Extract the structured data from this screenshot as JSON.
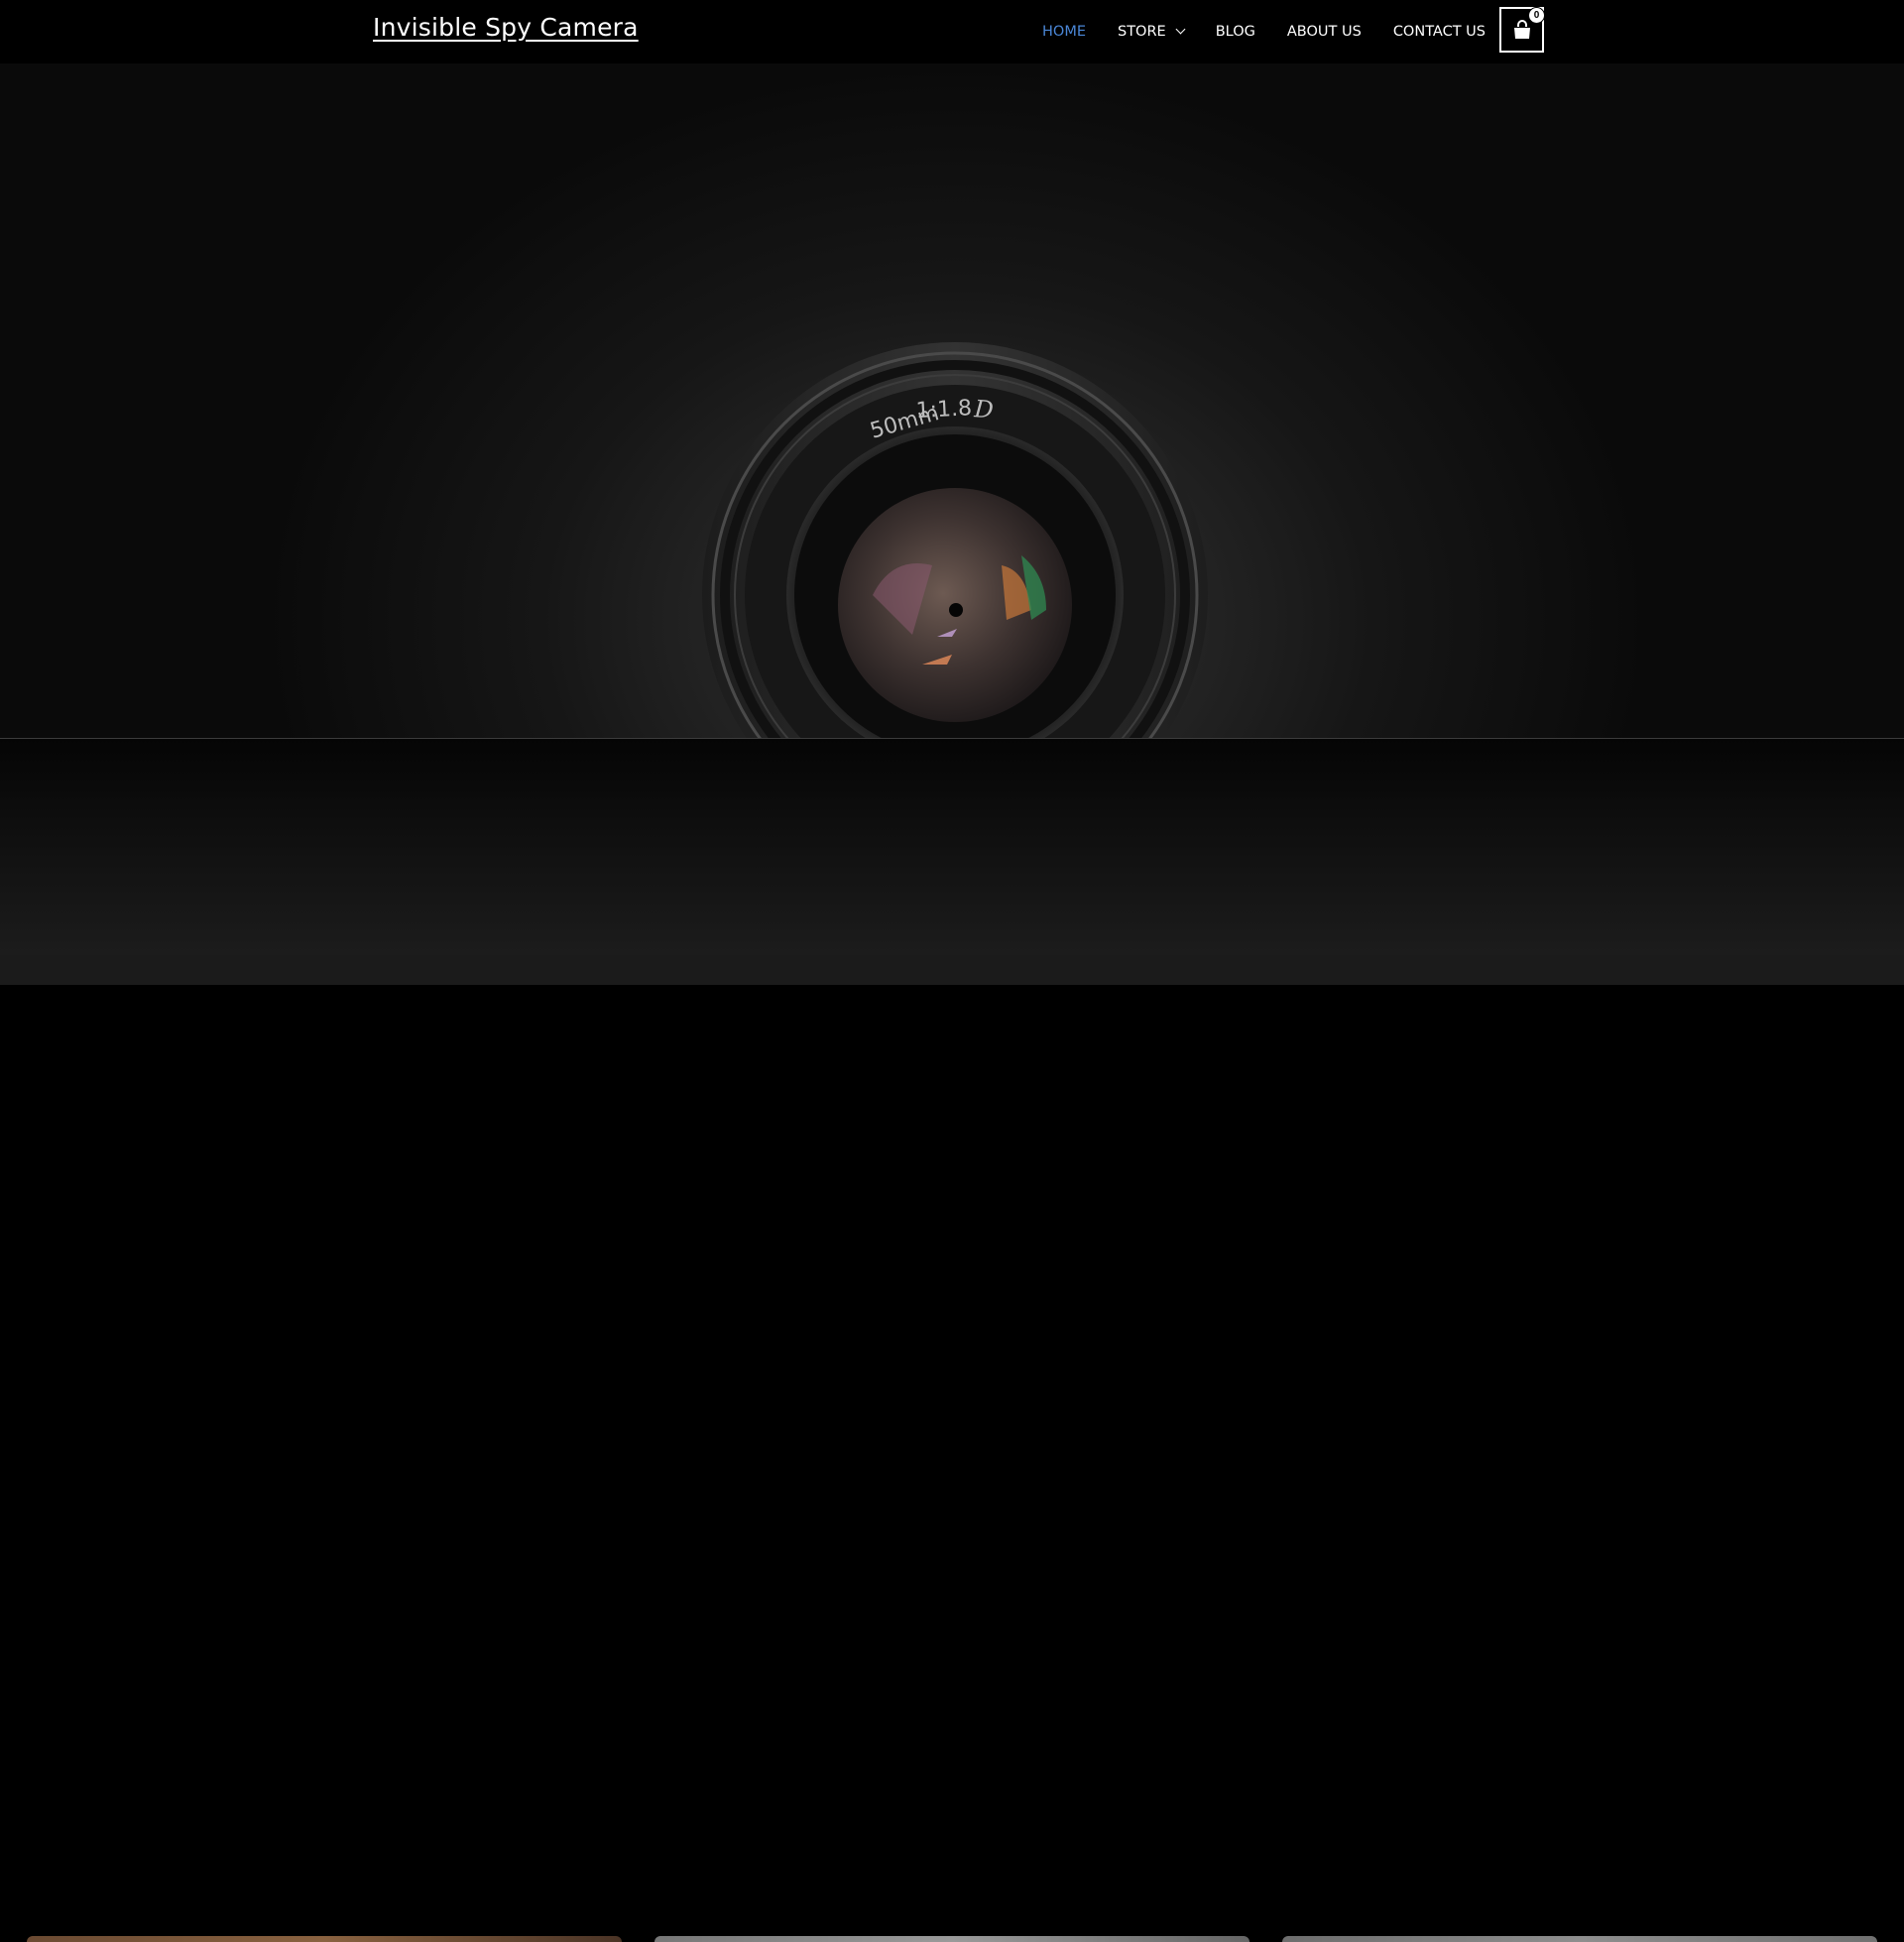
{
  "header": {
    "site_title": "Invisible Spy Camera",
    "nav": [
      {
        "label": "HOME",
        "active": true
      },
      {
        "label": "STORE",
        "has_dropdown": true
      },
      {
        "label": "BLOG"
      },
      {
        "label": "ABOUT US"
      },
      {
        "label": "CONTACT US"
      }
    ],
    "cart": {
      "count": "0",
      "icon": "shopping-bag-icon"
    },
    "accent_color": "#4a86d6"
  },
  "hero": {
    "image": "camera-lens-photo",
    "lens_markings": {
      "focal": "50mm",
      "aperture": "1:1.8",
      "series": "D"
    }
  }
}
